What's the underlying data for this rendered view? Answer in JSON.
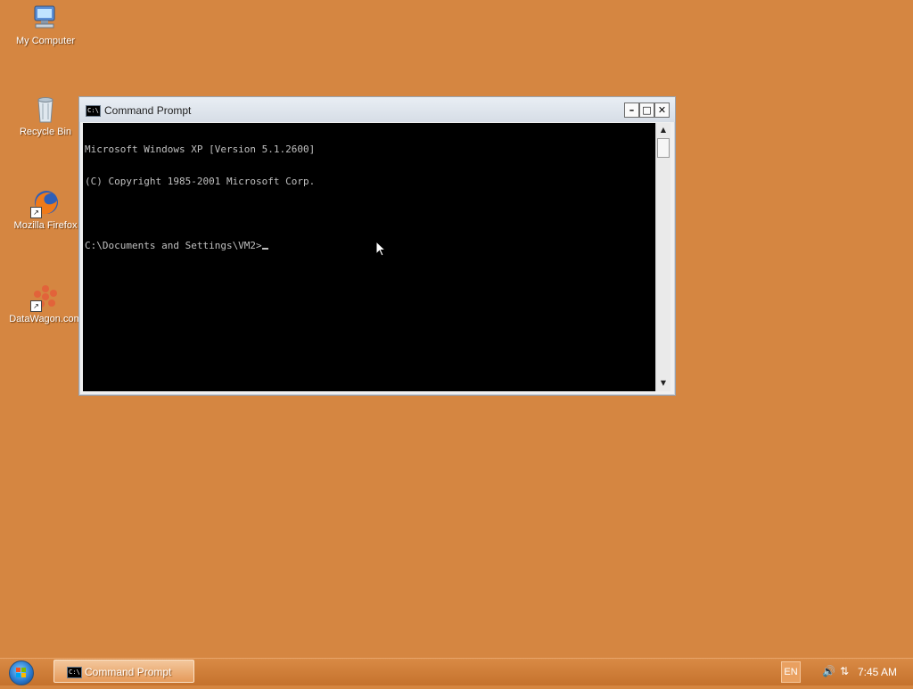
{
  "desktop": {
    "icons": [
      {
        "label": "My Computer"
      },
      {
        "label": "Recycle Bin"
      },
      {
        "label": "Mozilla Firefox"
      },
      {
        "label": "DataWagon.com"
      }
    ]
  },
  "window": {
    "title": "Command Prompt",
    "icon_text": "C:\\",
    "controls": {
      "minimize": "–",
      "maximize": "□",
      "close": "✕"
    },
    "console_lines": [
      "Microsoft Windows XP [Version 5.1.2600]",
      "(C) Copyright 1985-2001 Microsoft Corp.",
      "",
      "C:\\Documents and Settings\\VM2>"
    ]
  },
  "taskbar": {
    "tasks": [
      {
        "label": "Command Prompt",
        "icon_text": "C:\\"
      }
    ],
    "language": "EN",
    "clock": "7:45 AM"
  },
  "colors": {
    "desktop_background": "#D58641",
    "console_background": "#000000",
    "console_text": "#C0C0C0"
  }
}
